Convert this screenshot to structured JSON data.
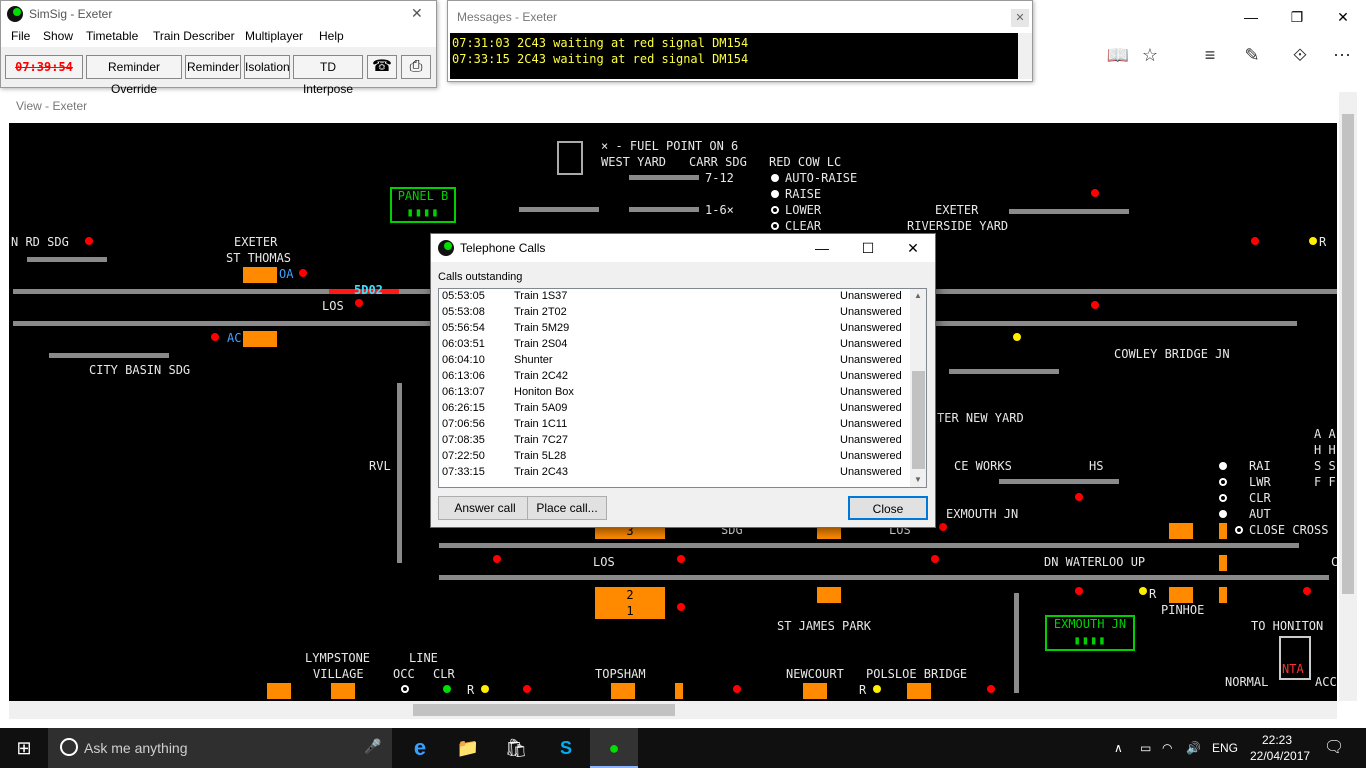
{
  "browser": {
    "controls": [
      "—",
      "❐",
      "✕"
    ],
    "tools": [
      "📖",
      "☆",
      "≡",
      "✎",
      "⟐",
      "⋯"
    ]
  },
  "simsig": {
    "title": "SimSig - Exeter",
    "close_glyph": "✕",
    "menu": [
      "File",
      "Show",
      "Timetable",
      "Train Describer",
      "Multiplayer",
      "Help"
    ],
    "clock": "07:39:54",
    "toolbar": [
      "Reminder Override",
      "Reminder",
      "Isolation",
      "TD Interpose"
    ],
    "phone_glyph": "☎",
    "print_glyph": "⎙"
  },
  "messages": {
    "title": "Messages - Exeter",
    "close_glyph": "✕",
    "lines": [
      "07:31:03 2C43 waiting at red signal DM154",
      "07:33:15 2C43 waiting at red signal DM154"
    ]
  },
  "view": {
    "title": "View - Exeter",
    "labels": {
      "fuel": "× - FUEL POINT ON 6",
      "west_yard": "WEST YARD",
      "carr_sdg": "CARR SDG",
      "red_cow": "RED COW LC",
      "seven_twelve": "7-12",
      "one_six": "1-6×",
      "auto_raise": "AUTO-RAISE",
      "raise": "RAISE",
      "lower": "LOWER",
      "clear": "CLEAR",
      "panel_b": "PANEL B",
      "exeter_riverside_1": "EXETER",
      "exeter_riverside_2": "RIVERSIDE YARD",
      "n_rd_sdg": "N RD SDG",
      "exeter_st_thomas_1": "EXETER",
      "exeter_st_thomas_2": "ST THOMAS",
      "berth_5d02": "5D02",
      "los1": "LOS",
      "city_basin": "CITY BASIN SDG",
      "ac": "AC",
      "oa": "OA",
      "cowley": "COWLEY BRIDGE JN",
      "new_yard": "TER NEW YARD",
      "rvl": "RVL",
      "ce_works": "CE WORKS",
      "hs": "HS",
      "rai": "RAI",
      "lwr": "LWR",
      "clr": "CLR",
      "aut": "AUT",
      "close_cross": "CLOSE CROSS",
      "exmouth_jn_top": "EXMOUTH JN",
      "los2": "LOS",
      "dn_waterloo": "DN WATERLOO UP",
      "sdg": "SDG",
      "los3": "LOS",
      "pinhoe": "PINHOE",
      "st_james": "ST JAMES PARK",
      "exmouth_jn_panel": "EXMOUTH JN",
      "to_honiton": "TO HONITON",
      "lympstone_1": "LYMPSTONE",
      "lympstone_2": "VILLAGE",
      "line": "LINE",
      "occ": "OCC",
      "clr2": "CLR",
      "topsham": "TOPSHAM",
      "newcourt": "NEWCOURT",
      "polsloe": "POLSLOE BRIDGE",
      "normal": "NORMAL",
      "acc": "ACC",
      "nta": "NTA",
      "r1": "R",
      "r2": "R",
      "r3": "R",
      "r4": "R",
      "berth_3": "3",
      "berth_2": "2",
      "berth_1": "1",
      "ahsf_1": "A A",
      "ahsf_2": "H H",
      "ahsf_3": "S S",
      "ahsf_4": "F F",
      "c_edge": "C"
    }
  },
  "telephone": {
    "title": "Telephone Calls",
    "list_label": "Calls outstanding",
    "calls": [
      {
        "time": "05:53:05",
        "caller": "Train 1S37",
        "status": "Unanswered"
      },
      {
        "time": "05:53:08",
        "caller": "Train 2T02",
        "status": "Unanswered"
      },
      {
        "time": "05:56:54",
        "caller": "Train 5M29",
        "status": "Unanswered"
      },
      {
        "time": "06:03:51",
        "caller": "Train 2S04",
        "status": "Unanswered"
      },
      {
        "time": "06:04:10",
        "caller": "Shunter",
        "status": "Unanswered"
      },
      {
        "time": "06:13:06",
        "caller": "Train 2C42",
        "status": "Unanswered"
      },
      {
        "time": "06:13:07",
        "caller": "Honiton Box",
        "status": "Unanswered"
      },
      {
        "time": "06:26:15",
        "caller": "Train 5A09",
        "status": "Unanswered"
      },
      {
        "time": "07:06:56",
        "caller": "Train 1C11",
        "status": "Unanswered"
      },
      {
        "time": "07:08:35",
        "caller": "Train 7C27",
        "status": "Unanswered"
      },
      {
        "time": "07:22:50",
        "caller": "Train 5L28",
        "status": "Unanswered"
      },
      {
        "time": "07:33:15",
        "caller": "Train 2C43",
        "status": "Unanswered"
      }
    ],
    "answer_label": "Answer call",
    "place_label": "Place call...",
    "close_label": "Close",
    "controls": [
      "—",
      "☐",
      "✕"
    ]
  },
  "taskbar": {
    "search_placeholder": "Ask me anything",
    "apps": [
      "e",
      "📁",
      "🛍",
      "S",
      "●"
    ],
    "tray": {
      "chevron": "∧",
      "lang": "ENG",
      "time": "22:23",
      "date": "22/04/2017"
    }
  }
}
